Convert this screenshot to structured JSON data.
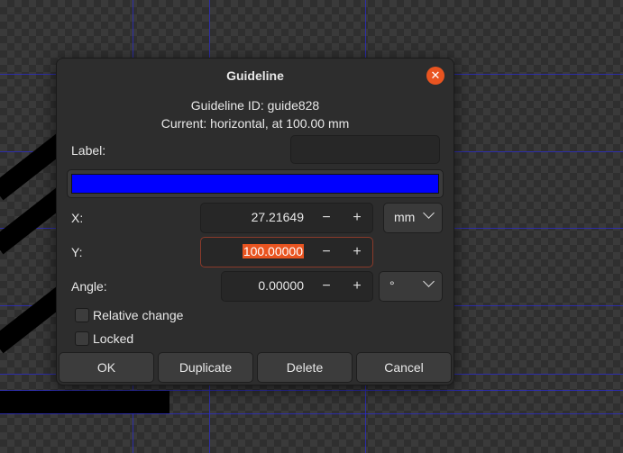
{
  "dialog": {
    "title": "Guideline",
    "guideline_id": "Guideline ID: guide828",
    "current": "Current: horizontal, at 100.00 mm",
    "label_text": "Label:",
    "label_value": "",
    "guide_color": "#0000ff",
    "x": {
      "label": "X:",
      "value": "27.21649"
    },
    "y": {
      "label": "Y:",
      "value": "100.00000"
    },
    "angle": {
      "label": "Angle:",
      "value": "0.00000"
    },
    "unit": "mm",
    "angle_unit": "°",
    "minus": "−",
    "plus": "+",
    "relative_change": "Relative change",
    "locked": "Locked",
    "buttons": {
      "ok": "OK",
      "duplicate": "Duplicate",
      "delete": "Delete",
      "cancel": "Cancel"
    }
  }
}
